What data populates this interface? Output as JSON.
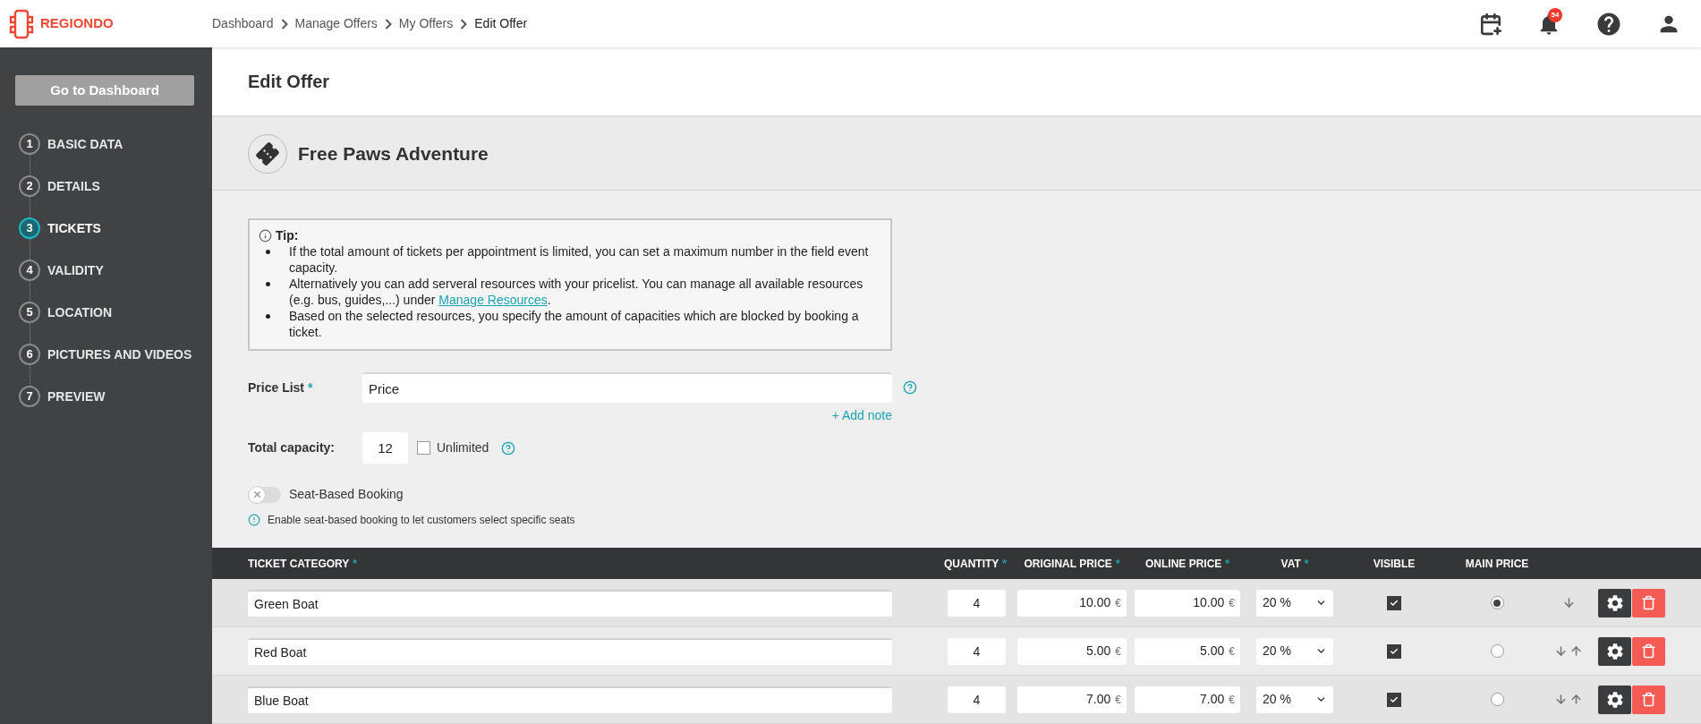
{
  "header": {
    "logo": "REGIONDO",
    "breadcrumbs": [
      "Dashboard",
      "Manage Offers",
      "My Offers",
      "Edit Offer"
    ],
    "notification_count": "54"
  },
  "sidebar": {
    "button": "Go to Dashboard",
    "steps": [
      {
        "number": "1",
        "label": "BASIC DATA",
        "selected": false
      },
      {
        "number": "2",
        "label": "DETAILS",
        "selected": false
      },
      {
        "number": "3",
        "label": "TICKETS",
        "selected": true
      },
      {
        "number": "4",
        "label": "VALIDITY",
        "selected": false
      },
      {
        "number": "5",
        "label": "LOCATION",
        "selected": false
      },
      {
        "number": "6",
        "label": "PICTURES AND VIDEOS",
        "selected": false
      },
      {
        "number": "7",
        "label": "PREVIEW",
        "selected": false
      }
    ]
  },
  "page_title": "Edit Offer",
  "offer_title": "Free Paws Adventure",
  "tip": {
    "title": "Tip:",
    "items": [
      {
        "text": "If the total amount of tickets per appointment is limited, you can set a maximum number in the field event capacity."
      },
      {
        "text": "Alternatively you can add serveral resources with your pricelist. You can manage all available resources (e.g. bus, guides,...) under ",
        "link": "Manage Resources",
        "after": "."
      },
      {
        "text": "Based on the selected resources, you specify the amount of capacities which are blocked by booking a ticket."
      }
    ]
  },
  "price_list": {
    "label": "Price List",
    "mark": "*",
    "value": "Price",
    "add_note": "+ Add note"
  },
  "capacity": {
    "label": "Total capacity:",
    "value": "12",
    "unlimited_label": "Unlimited",
    "unlimited_checked": false
  },
  "seat_booking": {
    "label": "Seat-Based Booking",
    "on": false,
    "hint": "Enable seat-based booking to let customers select specific seats"
  },
  "table": {
    "columns": [
      {
        "label": "TICKET CATEGORY",
        "mark": "*"
      },
      {
        "label": "QUANTITY",
        "mark": "*"
      },
      {
        "label": "ORIGINAL PRICE",
        "mark": "*"
      },
      {
        "label": "ONLINE PRICE",
        "mark": "*"
      },
      {
        "label": "VAT",
        "mark": "*"
      },
      {
        "label": "VISIBLE"
      },
      {
        "label": "MAIN PRICE"
      }
    ],
    "rows": [
      {
        "name": "Green Boat",
        "quantity": "4",
        "original_price": "10.00",
        "original_currency": "€",
        "online_price": "10.00",
        "online_currency": "€",
        "vat": "20 %",
        "visible": true,
        "main": true,
        "move_down": true,
        "move_up": false
      },
      {
        "name": "Red Boat",
        "quantity": "4",
        "original_price": "5.00",
        "original_currency": "€",
        "online_price": "5.00",
        "online_currency": "€",
        "vat": "20 %",
        "visible": true,
        "main": false,
        "move_down": true,
        "move_up": true
      },
      {
        "name": "Blue Boat",
        "quantity": "4",
        "original_price": "7.00",
        "original_currency": "€",
        "online_price": "7.00",
        "online_currency": "€",
        "vat": "20 %",
        "visible": true,
        "main": false,
        "move_down": true,
        "move_up": true
      }
    ]
  }
}
